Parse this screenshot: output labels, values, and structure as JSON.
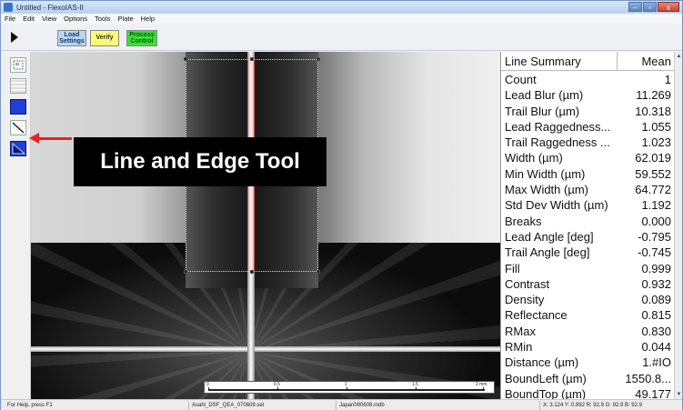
{
  "window": {
    "title": "Untitled - FlexoIAS-II",
    "controls": {
      "minimize": "–",
      "maximize": "▫",
      "close": "x"
    }
  },
  "menu": [
    "File",
    "Edit",
    "View",
    "Options",
    "Tools",
    "Plate",
    "Help"
  ],
  "toolbar": {
    "play_icon": "play-icon",
    "load_settings": [
      "Load",
      "Settings"
    ],
    "verify": "Verify",
    "process_control": [
      "Process",
      "Control"
    ]
  },
  "left_tools": [
    "select-tool-icon",
    "grid-tool-icon",
    "rectangle-tool-icon",
    "line-and-edge-tool-icon",
    "area-tool-icon"
  ],
  "annotation": {
    "text": "Line and Edge Tool",
    "arrow_color": "#e8202a"
  },
  "scale_bar": {
    "labels": [
      "0",
      "0.5",
      "1",
      "1.5",
      "2 mm"
    ]
  },
  "line_summary": {
    "header": {
      "label": "Line Summary",
      "value": "Mean"
    },
    "rows": [
      {
        "label": "Count",
        "value": "1"
      },
      {
        "label": "Lead Blur (µm)",
        "value": "11.269"
      },
      {
        "label": "Trail Blur (µm)",
        "value": "10.318"
      },
      {
        "label": "Lead Raggedness...",
        "value": "1.055"
      },
      {
        "label": "Trail Raggedness ...",
        "value": "1.023"
      },
      {
        "label": "Width (µm)",
        "value": "62.019"
      },
      {
        "label": "Min Width (µm)",
        "value": "59.552"
      },
      {
        "label": "Max Width (µm)",
        "value": "64.772"
      },
      {
        "label": "Std Dev Width (µm)",
        "value": "1.192"
      },
      {
        "label": "Breaks",
        "value": "0.000"
      },
      {
        "label": "Lead Angle [deg]",
        "value": "-0.795"
      },
      {
        "label": "Trail Angle [deg]",
        "value": "-0.745"
      },
      {
        "label": "Fill",
        "value": "0.999"
      },
      {
        "label": "Contrast",
        "value": "0.932"
      },
      {
        "label": "Density",
        "value": "0.089"
      },
      {
        "label": "Reflectance",
        "value": "0.815"
      },
      {
        "label": "RMax",
        "value": "0.830"
      },
      {
        "label": "RMin",
        "value": "0.044"
      },
      {
        "label": "Distance (µm)",
        "value": "1.#IO"
      },
      {
        "label": "BoundLeft (µm)",
        "value": "1550.8..."
      },
      {
        "label": "BoundTop (µm)",
        "value": "49.177"
      }
    ]
  },
  "status": {
    "help": "For Help, press F1",
    "settings_file": "Asahi_DSF_QEA_070609.set",
    "database": "Japan090608.mdb",
    "coords": "X: 3.124  Y: 0.892  R: 92.9  G: 92.9  B: 92.9"
  },
  "colors": {
    "load_settings_bg": "#b7d6f2",
    "verify_bg": "#fbfb74",
    "process_control_bg": "#38e038",
    "tool_active": "#1f3fd8",
    "selection_edge": "#e04848"
  }
}
